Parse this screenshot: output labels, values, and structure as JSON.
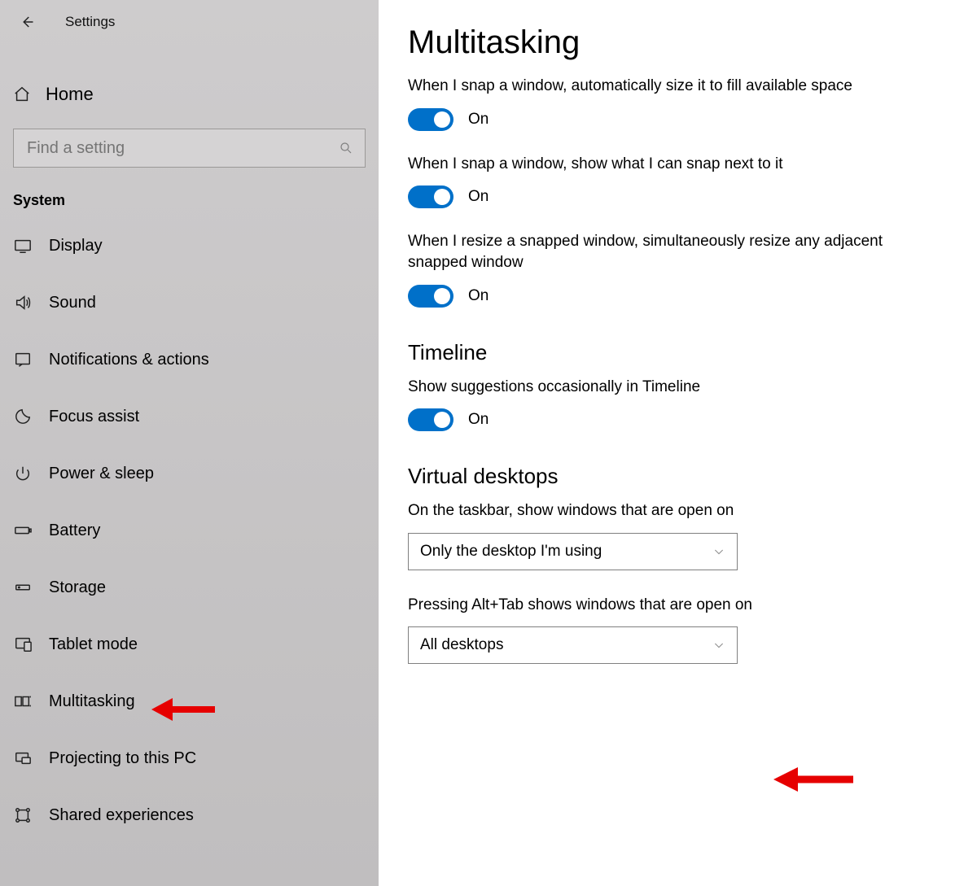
{
  "titlebar": {
    "title": "Settings"
  },
  "home": {
    "label": "Home"
  },
  "search": {
    "placeholder": "Find a setting"
  },
  "sidebar": {
    "group": "System",
    "items": [
      {
        "label": "Display"
      },
      {
        "label": "Sound"
      },
      {
        "label": "Notifications & actions"
      },
      {
        "label": "Focus assist"
      },
      {
        "label": "Power & sleep"
      },
      {
        "label": "Battery"
      },
      {
        "label": "Storage"
      },
      {
        "label": "Tablet mode"
      },
      {
        "label": "Multitasking"
      },
      {
        "label": "Projecting to this PC"
      },
      {
        "label": "Shared experiences"
      }
    ]
  },
  "main": {
    "title": "Multitasking",
    "settings": [
      {
        "desc": "When I snap a window, automatically size it to fill available space",
        "state": "On"
      },
      {
        "desc": "When I snap a window, show what I can snap next to it",
        "state": "On"
      },
      {
        "desc": "When I resize a snapped window, simultaneously resize any adjacent snapped window",
        "state": "On"
      }
    ],
    "timeline": {
      "heading": "Timeline",
      "desc": "Show suggestions occasionally in Timeline",
      "state": "On"
    },
    "virtual": {
      "heading": "Virtual desktops",
      "taskbar_label": "On the taskbar, show windows that are open on",
      "taskbar_value": "Only the desktop I'm using",
      "alttab_label": "Pressing Alt+Tab shows windows that are open on",
      "alttab_value": "All desktops"
    }
  }
}
